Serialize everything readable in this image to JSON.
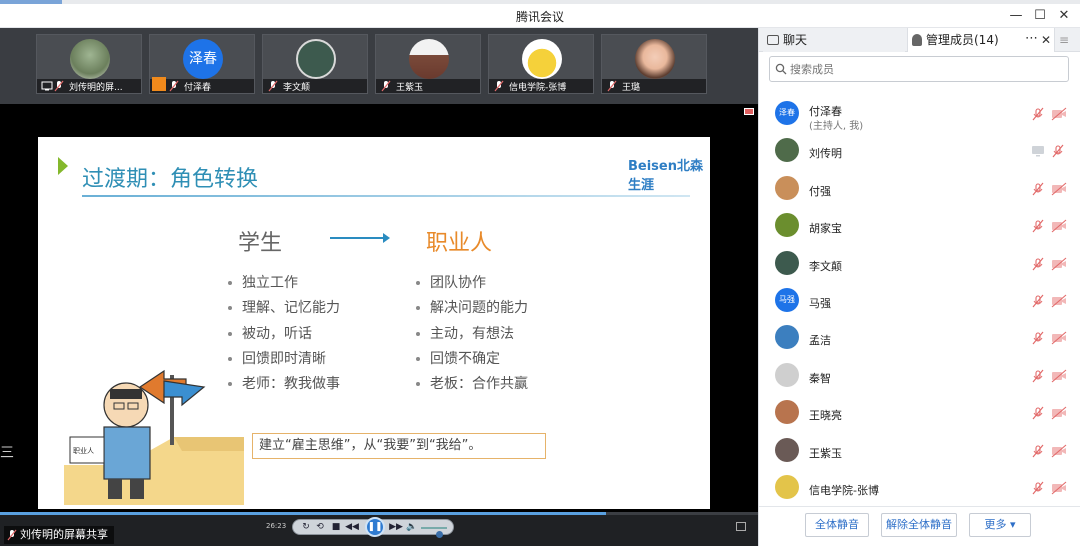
{
  "window": {
    "title": "腾讯会议",
    "minimize_icon": "minimize-icon",
    "maximize_icon": "maximize-icon",
    "close_icon": "close-icon"
  },
  "participants_strip": [
    {
      "name": "刘传明的屏...",
      "avatar": "plant-photo",
      "sharing": true
    },
    {
      "name": "付泽春",
      "avatar_text": "泽春",
      "avatar_color": "#1e73e8",
      "host_badge": true
    },
    {
      "name": "李文颠",
      "avatar": "ink-seal"
    },
    {
      "name": "王紫玉",
      "avatar": "person-photo"
    },
    {
      "name": "信电学院-张博",
      "avatar": "pikachu-photo"
    },
    {
      "name": "王璐",
      "avatar": "woman-photo"
    }
  ],
  "slide": {
    "title": "过渡期：角色转换",
    "logo": "Beisen北森生涯",
    "left_heading": "学生",
    "right_heading": "职业人",
    "left_items": [
      "独立工作",
      "理解、记忆能力",
      "被动，听话",
      "回馈即时清晰",
      "老师：教我做事"
    ],
    "right_items": [
      "团队协作",
      "解决问题的能力",
      "主动，有想法",
      "回馈不确定",
      "老板：合作共赢"
    ],
    "note": "建立“雇主思维”，从“我要”到“我给”。",
    "sign_text": "职业人"
  },
  "player": {
    "time": "26:23",
    "progress": 0.8,
    "volume": 0.7,
    "share_label": "刘传明的屏幕共享",
    "side_toggle": "三"
  },
  "panel": {
    "tab_chat": "聊天",
    "tab_members": "管理成员(14)",
    "more_icon": "more-icon",
    "search_placeholder": "搜索成员",
    "members": [
      {
        "name": "付泽春",
        "role": "(主持人, 我)",
        "avatar_text": "泽春",
        "avatar_color": "#1e73e8"
      },
      {
        "name": "刘传明",
        "avatar_color": "#4f6b4a",
        "sharing": true
      },
      {
        "name": "付强",
        "avatar_color": "#c98f5a"
      },
      {
        "name": "胡家宝",
        "avatar_color": "#6b8e2e"
      },
      {
        "name": "李文颠",
        "avatar_color": "#3d5a4e"
      },
      {
        "name": "马强",
        "avatar_text": "马强",
        "avatar_color": "#1e73e8"
      },
      {
        "name": "孟洁",
        "avatar_color": "#3c7fbf"
      },
      {
        "name": "秦智",
        "avatar_color": "#cfcfcf"
      },
      {
        "name": "王晓亮",
        "avatar_color": "#b8744e"
      },
      {
        "name": "王紫玉",
        "avatar_color": "#6a5a56"
      },
      {
        "name": "信电学院-张博",
        "avatar_color": "#e3c44a"
      }
    ],
    "buttons": {
      "mute_all": "全体静音",
      "unmute_all": "解除全体静音",
      "more": "更多 ▾"
    }
  },
  "colors": {
    "accent": "#2e6fc8",
    "mic_muted": "#e26a6a",
    "cam_off": "#e8a0a0"
  }
}
